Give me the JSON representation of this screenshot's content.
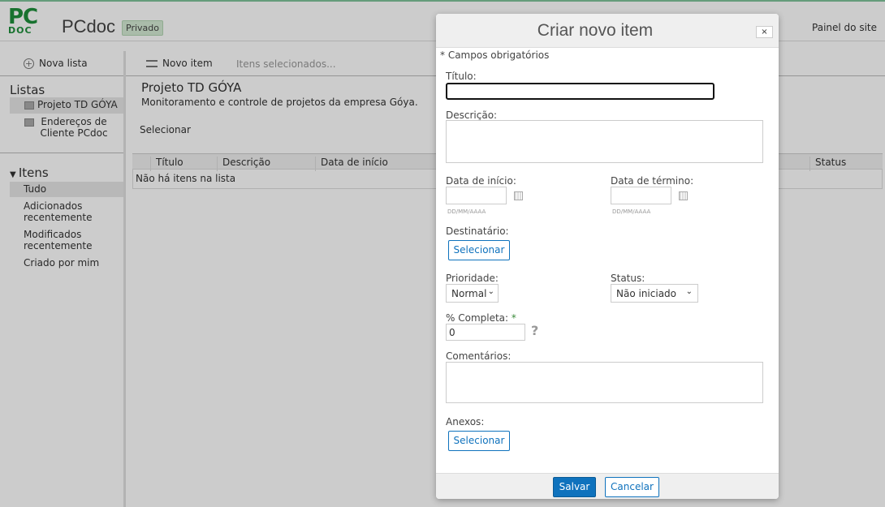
{
  "header": {
    "logo": "PC DOC",
    "site_title": "PCdoc",
    "privacy_badge": "Privado",
    "site_panel_link": "Painel do site"
  },
  "sidebar": {
    "new_list": "Nova lista",
    "lists_heading": "Listas",
    "lists": [
      {
        "label": "Projeto TD GÓYA",
        "selected": true
      },
      {
        "label": "Endereços de Cliente PCdoc",
        "selected": false
      }
    ],
    "items_heading": "Itens",
    "views": [
      {
        "label": "Tudo",
        "selected": true
      },
      {
        "label": "Adicionados recentemente"
      },
      {
        "label": "Modificados recentemente"
      },
      {
        "label": "Criado por mim"
      }
    ]
  },
  "toolbar": {
    "new_item": "Novo item",
    "selected_items": "Itens selecionados..."
  },
  "main": {
    "list_title": "Projeto TD GÓYA",
    "list_description": "Monitoramento e controle de projetos da empresa Góya.",
    "select_label": "Selecionar",
    "columns": [
      "Título",
      "Descrição",
      "Data de início",
      "Status"
    ],
    "empty_message": "Não há itens na lista"
  },
  "modal": {
    "title": "Criar novo item",
    "close": "×",
    "required_note": "* Campos obrigatórios",
    "fields": {
      "title_label": "Título:",
      "title_value": "",
      "description_label": "Descrição:",
      "start_label": "Data de início:",
      "end_label": "Data de término:",
      "date_hint": "DD/MM/AAAA",
      "recipient_label": "Destinatário:",
      "select_button": "Selecionar",
      "priority_label": "Prioridade:",
      "priority_value": "Normal",
      "status_label": "Status:",
      "status_value": "Não iniciado",
      "percent_label": "% Completa:",
      "required_mark": "*",
      "percent_value": "0",
      "help": "?",
      "comments_label": "Comentários:",
      "attachments_label": "Anexos:"
    },
    "save": "Salvar",
    "cancel": "Cancelar"
  },
  "colors": {
    "brand_green": "#1e8f3b",
    "accent_blue": "#0f72bd"
  }
}
